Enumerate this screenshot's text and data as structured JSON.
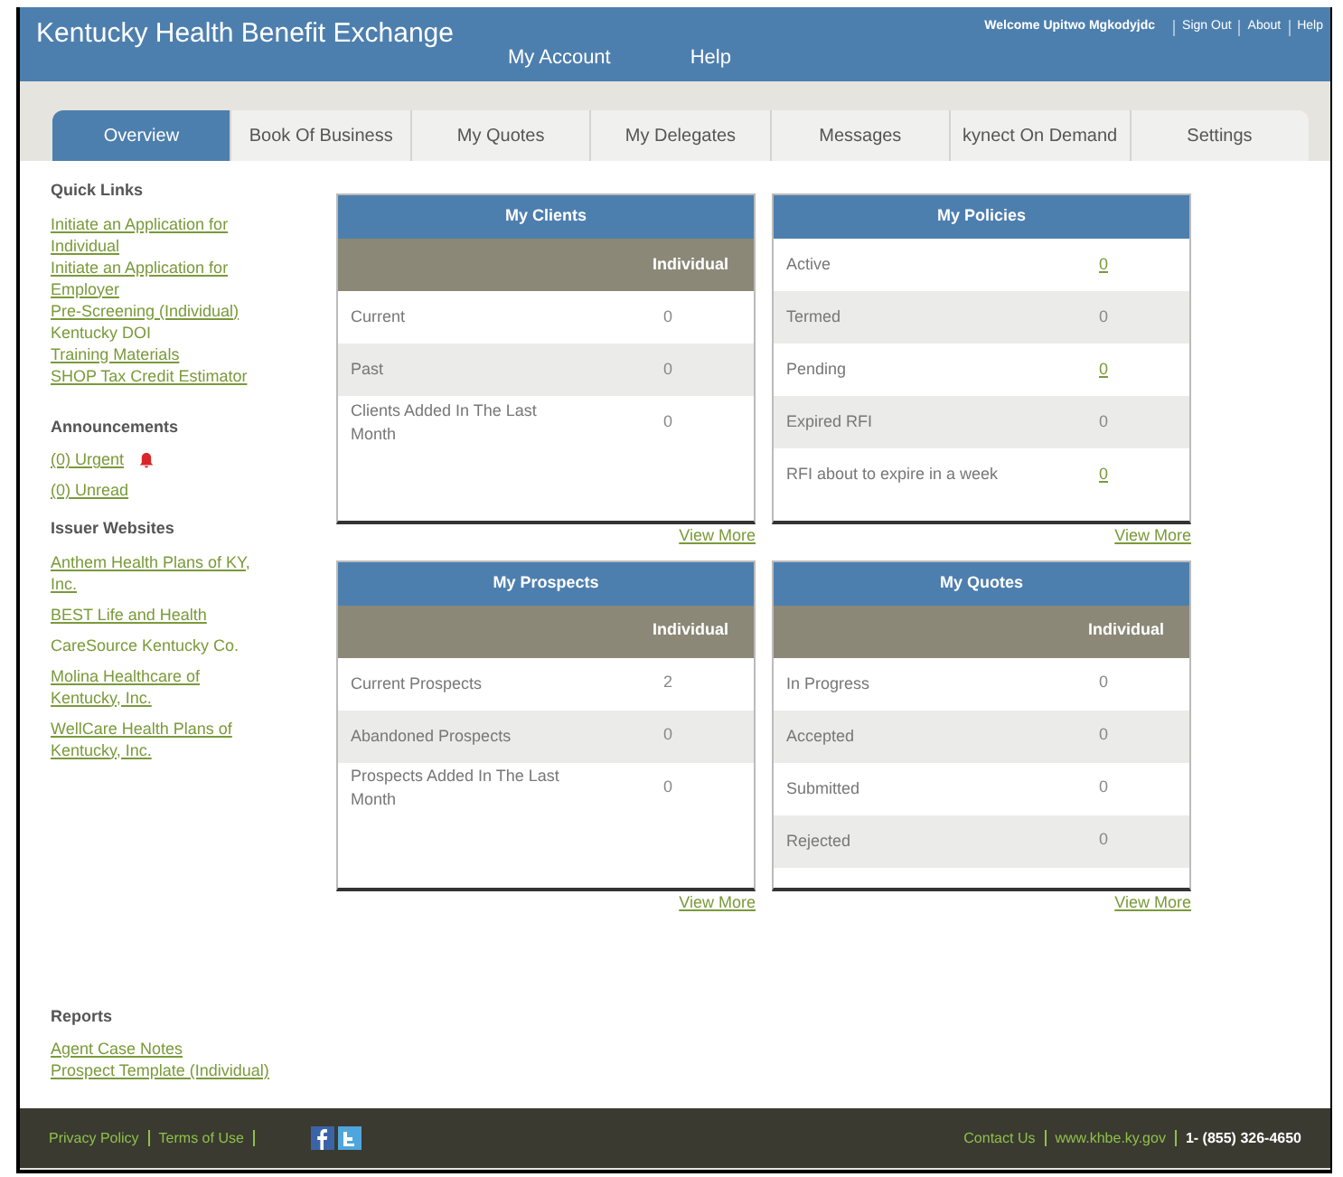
{
  "header": {
    "title": "Kentucky Health Benefit Exchange",
    "nav": [
      "My Account",
      "Help"
    ],
    "welcome": "Welcome Upitwo Mgkodyjdc",
    "utility_links": [
      "Sign Out",
      "About",
      "Help"
    ]
  },
  "tabs": [
    {
      "label": "Overview",
      "selected": true
    },
    {
      "label": "Book Of Business",
      "selected": false
    },
    {
      "label": "My Quotes",
      "selected": false
    },
    {
      "label": "My Delegates",
      "selected": false
    },
    {
      "label": "Messages",
      "selected": false
    },
    {
      "label": "kynect On Demand",
      "selected": false
    },
    {
      "label": "Settings",
      "selected": false
    }
  ],
  "sidebar": [
    {
      "heading": "Quick Links",
      "items": [
        {
          "label": "Initiate an Application for Individual",
          "underlined": true
        },
        {
          "label": "Initiate an Application for Employer",
          "underlined": true
        },
        {
          "label": "Pre-Screening (Individual)",
          "underlined": true
        },
        {
          "label": "Kentucky DOI",
          "underlined": false
        },
        {
          "label": "Training Materials",
          "underlined": true
        },
        {
          "label": "SHOP Tax Credit Estimator",
          "underlined": true
        }
      ]
    },
    {
      "heading": "Announcements",
      "items": [
        {
          "label": "(0) Urgent",
          "underlined": true,
          "kind": "urgent"
        },
        {
          "label": "(0) Unread",
          "underlined": true
        }
      ]
    },
    {
      "heading": "Issuer Websites",
      "items": [
        {
          "label": "Anthem Health Plans of KY, Inc.",
          "underlined": true
        },
        {
          "label": "BEST Life and Health",
          "underlined": true
        },
        {
          "label": "CareSource Kentucky Co.",
          "underlined": false
        },
        {
          "label": "Molina Healthcare of Kentucky, Inc.",
          "underlined": true
        },
        {
          "label": "WellCare Health Plans of Kentucky, Inc.",
          "underlined": true
        }
      ]
    },
    {
      "heading": "Reports",
      "items": [
        {
          "label": "Agent Case Notes",
          "underlined": true
        },
        {
          "label": "Prospect Template (Individual)",
          "underlined": true
        }
      ]
    }
  ],
  "panels": [
    {
      "title": "My Clients",
      "column": "Individual",
      "rows": [
        {
          "label": "Current",
          "value": "0",
          "linked": false
        },
        {
          "label": "Past",
          "value": "0",
          "linked": false
        },
        {
          "label": "Clients Added In The Last Month",
          "value": "0",
          "linked": false
        }
      ],
      "view_more": "View More"
    },
    {
      "title": "My Policies",
      "rows": [
        {
          "label": "Active",
          "value": "0",
          "linked": true
        },
        {
          "label": "Termed",
          "value": "0",
          "linked": false
        },
        {
          "label": "Pending",
          "value": "0",
          "linked": true
        },
        {
          "label": "Expired RFI",
          "value": "0",
          "linked": false
        },
        {
          "label": "RFI about to expire in a week",
          "value": "0",
          "linked": true
        }
      ],
      "view_more": "View More"
    },
    {
      "title": "My Prospects",
      "column": "Individual",
      "rows": [
        {
          "label": "Current Prospects",
          "value": "2",
          "linked": false
        },
        {
          "label": "Abandoned Prospects",
          "value": "0",
          "linked": false
        },
        {
          "label": "Prospects Added In The Last Month",
          "value": "0",
          "linked": false
        }
      ],
      "view_more": "View More"
    },
    {
      "title": "My Quotes",
      "column": "Individual",
      "rows": [
        {
          "label": "In Progress",
          "value": "0",
          "linked": false
        },
        {
          "label": "Accepted",
          "value": "0",
          "linked": false
        },
        {
          "label": "Submitted",
          "value": "0",
          "linked": false
        },
        {
          "label": "Rejected",
          "value": "0",
          "linked": false
        }
      ],
      "view_more": "View More"
    }
  ],
  "footer": {
    "left_links": [
      "Privacy Policy",
      "Terms of Use"
    ],
    "right_links": [
      "Contact Us",
      "www.khbe.ky.gov"
    ],
    "phone": "1- (855) 326-4650"
  }
}
